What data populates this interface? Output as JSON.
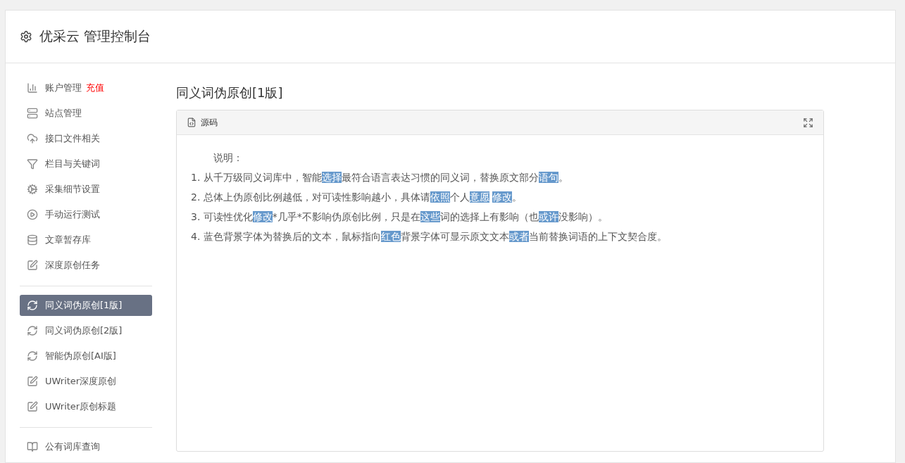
{
  "header": {
    "title": "优采云 管理控制台"
  },
  "sidebar": {
    "groups": [
      {
        "items": [
          {
            "label": "账户管理",
            "badge": "充值",
            "selected": false
          },
          {
            "label": "站点管理",
            "selected": false
          },
          {
            "label": "接口文件相关",
            "selected": false
          },
          {
            "label": "栏目与关键词",
            "selected": false
          },
          {
            "label": "采集细节设置",
            "selected": false
          },
          {
            "label": "手动运行测试",
            "selected": false
          },
          {
            "label": "文章暂存库",
            "selected": false
          },
          {
            "label": "深度原创任务",
            "selected": false
          }
        ]
      },
      {
        "items": [
          {
            "label": "同义词伪原创[1版]",
            "selected": true
          },
          {
            "label": "同义词伪原创[2版]",
            "selected": false
          },
          {
            "label": "智能伪原创[AI版]",
            "selected": false
          },
          {
            "label": "UWriter深度原创",
            "selected": false
          },
          {
            "label": "UWriter原创标题",
            "selected": false
          }
        ]
      },
      {
        "items": [
          {
            "label": "公有词库查询",
            "selected": false
          }
        ]
      }
    ]
  },
  "main": {
    "heading": "同义词伪原创[1版]",
    "panel": {
      "title": "源码",
      "intro": "说明：",
      "lines": [
        [
          {
            "kind": "plain",
            "text": "1. 从千万级同义词库中，智能"
          },
          {
            "kind": "swap",
            "text": "选择"
          },
          {
            "kind": "plain",
            "text": "最符合语言表达习惯的同义词，替换原文部分"
          },
          {
            "kind": "swap",
            "text": "语句"
          },
          {
            "kind": "plain",
            "text": "。"
          }
        ],
        [
          {
            "kind": "plain",
            "text": "2. 总体上伪原创比例越低，对可读性影响越小，具体请"
          },
          {
            "kind": "swap",
            "text": "依照"
          },
          {
            "kind": "plain",
            "text": "个人"
          },
          {
            "kind": "swap",
            "text": "意愿"
          },
          {
            "kind": "swap",
            "text": "修改"
          },
          {
            "kind": "plain",
            "text": "。"
          }
        ],
        [
          {
            "kind": "plain",
            "text": "3. 可读性优化"
          },
          {
            "kind": "swap",
            "text": "修改"
          },
          {
            "kind": "plain",
            "text": "*几乎*不影响伪原创比例，只是在"
          },
          {
            "kind": "swap",
            "text": "这些"
          },
          {
            "kind": "plain",
            "text": "词的选择上有影响（也"
          },
          {
            "kind": "swap",
            "text": "或许"
          },
          {
            "kind": "plain",
            "text": "没影响）。"
          }
        ],
        [
          {
            "kind": "plain",
            "text": "4. 蓝色背景字体为替换后的文本，鼠标指向"
          },
          {
            "kind": "swap",
            "text": "红色"
          },
          {
            "kind": "plain",
            "text": "背景字体可显示原文文本"
          },
          {
            "kind": "swap",
            "text": "或者"
          },
          {
            "kind": "plain",
            "text": "当前替换词语的上下文契合度。"
          }
        ]
      ]
    }
  }
}
